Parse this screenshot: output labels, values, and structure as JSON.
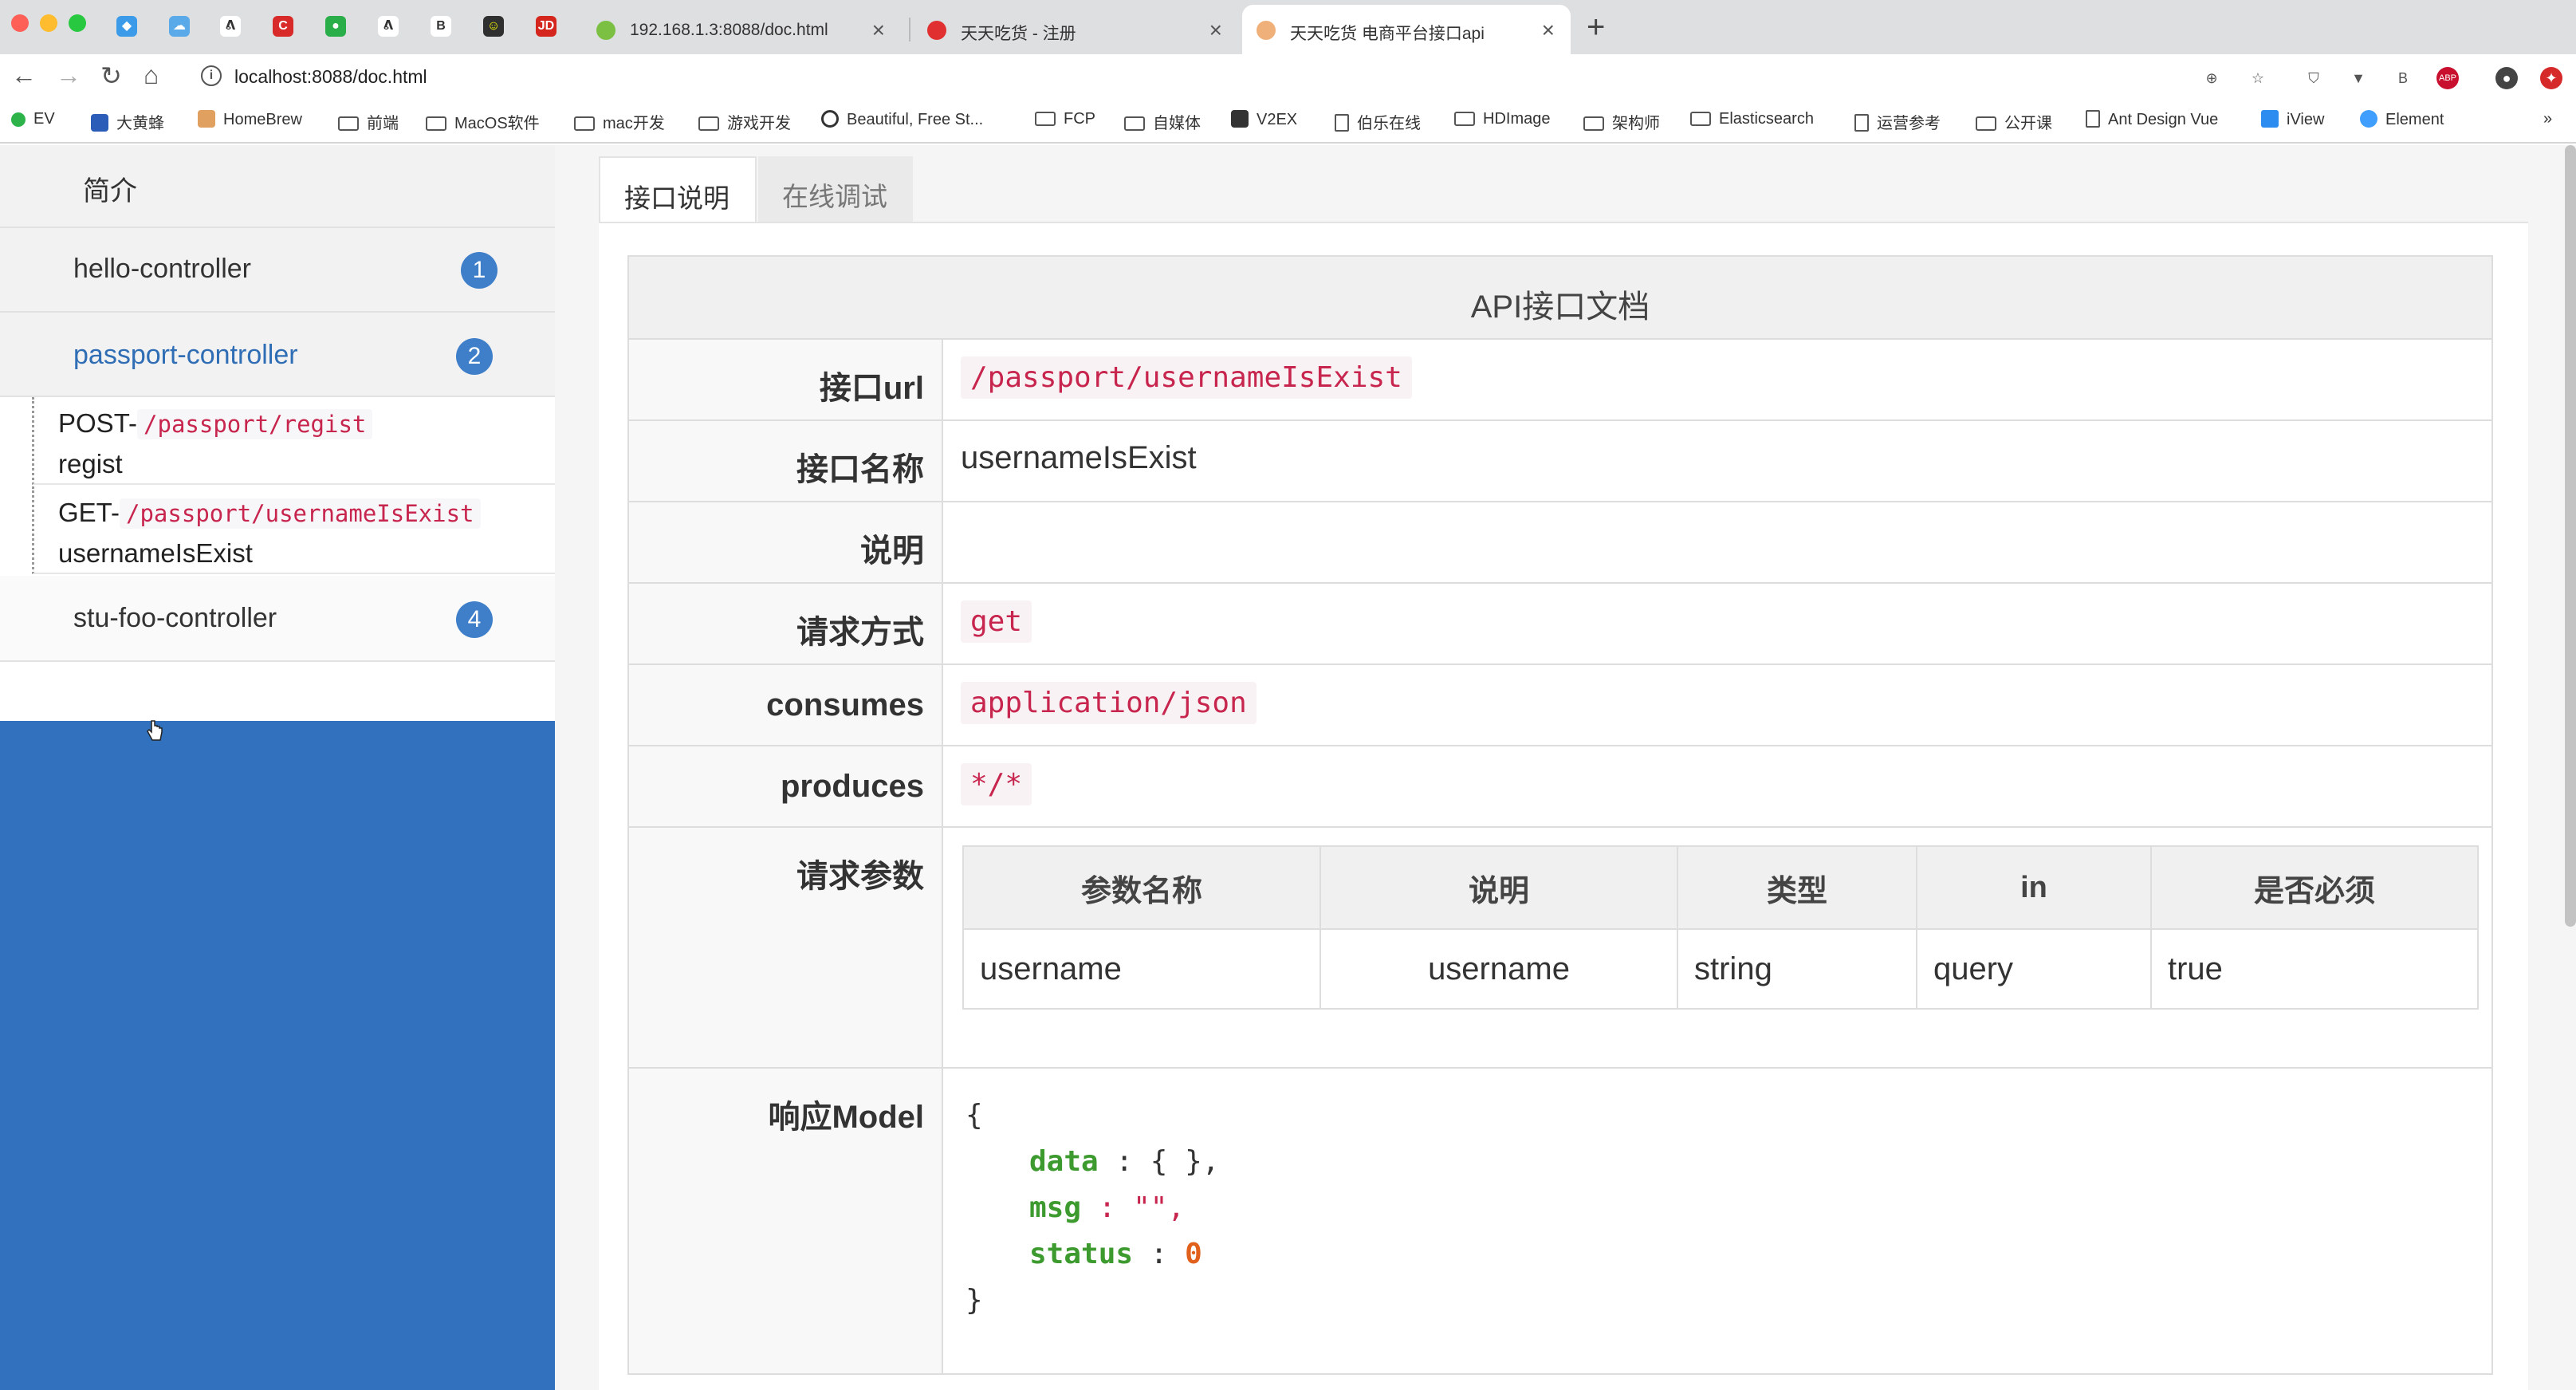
{
  "browser": {
    "tabs": [
      {
        "title": "192.168.1.3:8088/doc.html"
      },
      {
        "title": "天天吃货 - 注册"
      },
      {
        "title": "天天吃货 电商平台接口api"
      }
    ],
    "address": "localhost:8088/doc.html",
    "bookmarks": [
      "EV",
      "大黄蜂",
      "HomeBrew",
      "前端",
      "MacOS软件",
      "mac开发",
      "游戏开发",
      "Beautiful, Free St...",
      "FCP",
      "自媒体",
      "V2EX",
      "伯乐在线",
      "HDImage",
      "架构师",
      "Elasticsearch",
      "运营参考",
      "公开课",
      "Ant Design Vue",
      "iView",
      "Element"
    ],
    "more": "»"
  },
  "sidebar": {
    "intro": "简介",
    "controllers": [
      {
        "label": "hello-controller",
        "count": "1"
      },
      {
        "label": "passport-controller",
        "count": "2"
      },
      {
        "label": "stu-foo-controller",
        "count": "4"
      }
    ],
    "endpoints": [
      {
        "method": "POST-",
        "path": "/passport/regist",
        "name": "regist"
      },
      {
        "method": "GET-",
        "path": "/passport/usernameIsExist",
        "name": "usernameIsExist"
      }
    ]
  },
  "doc": {
    "tabs": [
      "接口说明",
      "在线调试"
    ],
    "title": "API接口文档",
    "rows": {
      "url_label": "接口url",
      "url": "/passport/usernameIsExist",
      "name_label": "接口名称",
      "name": "usernameIsExist",
      "desc_label": "说明",
      "desc": "",
      "method_label": "请求方式",
      "method": "get",
      "consumes_label": "consumes",
      "consumes": "application/json",
      "produces_label": "produces",
      "produces": "*/*",
      "params_label": "请求参数",
      "response_label": "响应Model"
    },
    "params_headers": [
      "参数名称",
      "说明",
      "类型",
      "in",
      "是否必须"
    ],
    "params_rows": [
      [
        "username",
        "username",
        "string",
        "query",
        "true"
      ]
    ],
    "model": {
      "open": "{",
      "close": "}",
      "k1": "data",
      "v1": ": { },",
      "k2": "msg",
      "v2": ": \"\",",
      "k3": "status",
      "v3_sep": ":",
      "v3": "0"
    }
  }
}
